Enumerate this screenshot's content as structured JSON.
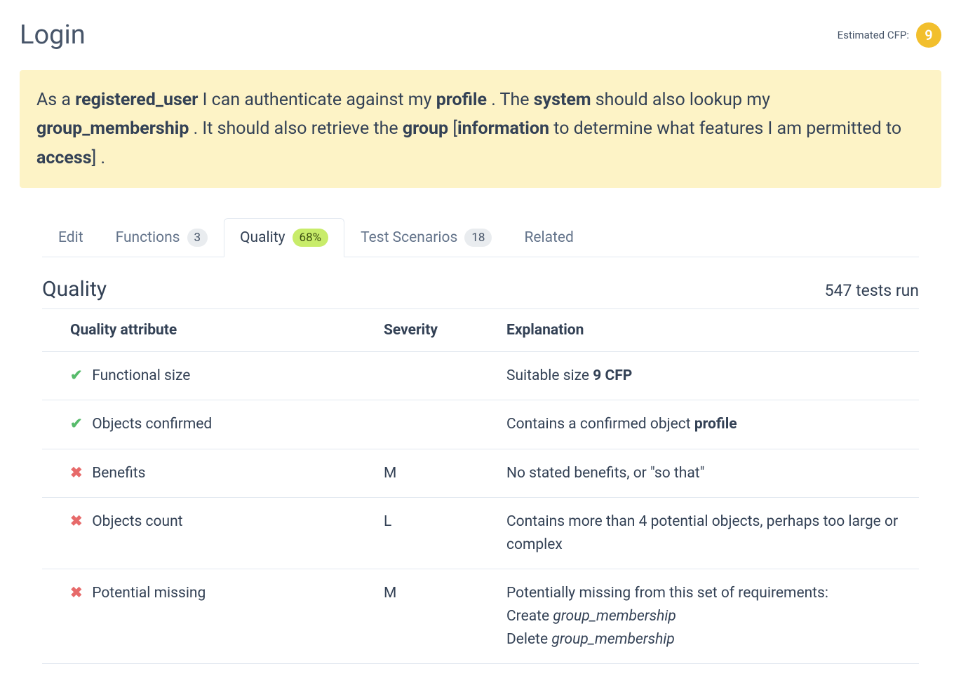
{
  "header": {
    "title": "Login",
    "cfp_label": "Estimated CFP:",
    "cfp_value": "9"
  },
  "story": {
    "parts": [
      {
        "t": "As a "
      },
      {
        "t": "registered_user",
        "b": true
      },
      {
        "t": " I can authenticate against my "
      },
      {
        "t": "profile",
        "b": true
      },
      {
        "t": " . The "
      },
      {
        "t": "system",
        "b": true
      },
      {
        "t": " should also lookup my "
      },
      {
        "t": "group_membership",
        "b": true
      },
      {
        "t": " . It should also retrieve the "
      },
      {
        "t": "group",
        "b": true
      },
      {
        "t": " ["
      },
      {
        "t": "information",
        "b": true
      },
      {
        "t": " to determine what features I am permitted to "
      },
      {
        "t": "access",
        "b": true
      },
      {
        "t": "] ."
      }
    ]
  },
  "tabs": {
    "edit": "Edit",
    "functions": "Functions",
    "functions_count": "3",
    "quality": "Quality",
    "quality_pct": "68%",
    "scenarios": "Test Scenarios",
    "scenarios_count": "18",
    "related": "Related"
  },
  "section": {
    "title": "Quality",
    "tests_run": "547 tests run"
  },
  "table": {
    "headers": {
      "attribute": "Quality attribute",
      "severity": "Severity",
      "explanation": "Explanation"
    },
    "rows": [
      {
        "status": "ok",
        "attribute": "Functional size",
        "severity": "",
        "explanation": [
          {
            "t": "Suitable size "
          },
          {
            "t": "9 CFP",
            "b": true
          }
        ]
      },
      {
        "status": "ok",
        "attribute": "Objects confirmed",
        "severity": "",
        "explanation": [
          {
            "t": "Contains a confirmed object "
          },
          {
            "t": "profile",
            "b": true
          }
        ]
      },
      {
        "status": "bad",
        "attribute": "Benefits",
        "severity": "M",
        "explanation": [
          {
            "t": "No stated benefits, or \"so that\""
          }
        ]
      },
      {
        "status": "bad",
        "attribute": "Objects count",
        "severity": "L",
        "explanation": [
          {
            "t": "Contains more than 4 potential objects, perhaps too large or complex"
          }
        ]
      },
      {
        "status": "bad",
        "attribute": "Potential missing",
        "severity": "M",
        "explanation": [
          {
            "t": "Potentially missing from this set of requirements:"
          },
          {
            "br": true
          },
          {
            "t": "Create "
          },
          {
            "t": "group_membership",
            "i": true
          },
          {
            "br": true
          },
          {
            "t": "Delete "
          },
          {
            "t": "group_membership",
            "i": true
          }
        ]
      }
    ]
  }
}
